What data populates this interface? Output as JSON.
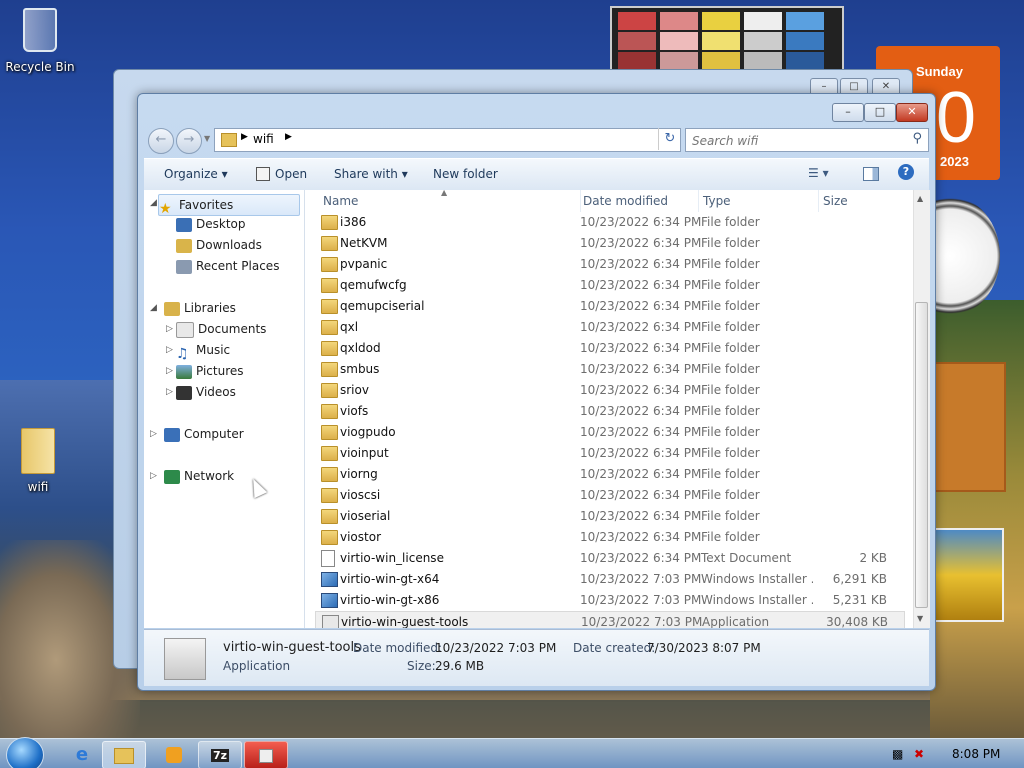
{
  "desktop": {
    "recycle_bin": "Recycle Bin",
    "folder_icon": "wifi"
  },
  "calendar_gadget": {
    "day": "Sunday",
    "date": "0",
    "year": "2023"
  },
  "window": {
    "address_folder": "wifi",
    "search_placeholder": "Search wifi",
    "toolbar": {
      "organize": "Organize ▾",
      "open": "Open",
      "share_with": "Share with ▾",
      "new_folder": "New folder"
    },
    "nav": {
      "favorites": "Favorites",
      "desktop": "Desktop",
      "downloads": "Downloads",
      "recent_places": "Recent Places",
      "libraries": "Libraries",
      "documents": "Documents",
      "music": "Music",
      "pictures": "Pictures",
      "videos": "Videos",
      "computer": "Computer",
      "network": "Network"
    },
    "columns": {
      "name": "Name",
      "date": "Date modified",
      "type": "Type",
      "size": "Size"
    },
    "files": [
      {
        "name": "i386",
        "date": "10/23/2022 6:34 PM",
        "type": "File folder",
        "size": "",
        "kind": "folder"
      },
      {
        "name": "NetKVM",
        "date": "10/23/2022 6:34 PM",
        "type": "File folder",
        "size": "",
        "kind": "folder"
      },
      {
        "name": "pvpanic",
        "date": "10/23/2022 6:34 PM",
        "type": "File folder",
        "size": "",
        "kind": "folder"
      },
      {
        "name": "qemufwcfg",
        "date": "10/23/2022 6:34 PM",
        "type": "File folder",
        "size": "",
        "kind": "folder"
      },
      {
        "name": "qemupciserial",
        "date": "10/23/2022 6:34 PM",
        "type": "File folder",
        "size": "",
        "kind": "folder"
      },
      {
        "name": "qxl",
        "date": "10/23/2022 6:34 PM",
        "type": "File folder",
        "size": "",
        "kind": "folder"
      },
      {
        "name": "qxldod",
        "date": "10/23/2022 6:34 PM",
        "type": "File folder",
        "size": "",
        "kind": "folder"
      },
      {
        "name": "smbus",
        "date": "10/23/2022 6:34 PM",
        "type": "File folder",
        "size": "",
        "kind": "folder"
      },
      {
        "name": "sriov",
        "date": "10/23/2022 6:34 PM",
        "type": "File folder",
        "size": "",
        "kind": "folder"
      },
      {
        "name": "viofs",
        "date": "10/23/2022 6:34 PM",
        "type": "File folder",
        "size": "",
        "kind": "folder"
      },
      {
        "name": "viogpudo",
        "date": "10/23/2022 6:34 PM",
        "type": "File folder",
        "size": "",
        "kind": "folder"
      },
      {
        "name": "vioinput",
        "date": "10/23/2022 6:34 PM",
        "type": "File folder",
        "size": "",
        "kind": "folder"
      },
      {
        "name": "viorng",
        "date": "10/23/2022 6:34 PM",
        "type": "File folder",
        "size": "",
        "kind": "folder"
      },
      {
        "name": "vioscsi",
        "date": "10/23/2022 6:34 PM",
        "type": "File folder",
        "size": "",
        "kind": "folder"
      },
      {
        "name": "vioserial",
        "date": "10/23/2022 6:34 PM",
        "type": "File folder",
        "size": "",
        "kind": "folder"
      },
      {
        "name": "viostor",
        "date": "10/23/2022 6:34 PM",
        "type": "File folder",
        "size": "",
        "kind": "folder"
      },
      {
        "name": "virtio-win_license",
        "date": "10/23/2022 6:34 PM",
        "type": "Text Document",
        "size": "2 KB",
        "kind": "text"
      },
      {
        "name": "virtio-win-gt-x64",
        "date": "10/23/2022 7:03 PM",
        "type": "Windows Installer ...",
        "size": "6,291 KB",
        "kind": "msi"
      },
      {
        "name": "virtio-win-gt-x86",
        "date": "10/23/2022 7:03 PM",
        "type": "Windows Installer ...",
        "size": "5,231 KB",
        "kind": "msi"
      },
      {
        "name": "virtio-win-guest-tools",
        "date": "10/23/2022 7:03 PM",
        "type": "Application",
        "size": "30,408 KB",
        "kind": "app"
      }
    ],
    "details": {
      "name": "virtio-win-guest-tools",
      "type": "Application",
      "date_modified_label": "Date modified:",
      "date_modified": "10/23/2022 7:03 PM",
      "date_created_label": "Date created:",
      "date_created": "7/30/2023 8:07 PM",
      "size_label": "Size:",
      "size": "29.6 MB"
    }
  },
  "taskbar": {
    "clock": "8:08 PM",
    "app_7z": "7z"
  },
  "colors": {
    "selection": "#dae8f9",
    "window_frame": "#b9d0ea",
    "calendar": "#e35e13"
  }
}
